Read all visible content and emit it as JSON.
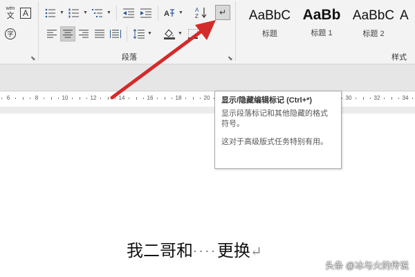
{
  "ribbon": {
    "font_group": {
      "phonetic_guide_text": "wén",
      "phonetic_guide_base": "文",
      "char_border_letter": "A",
      "enclose_char": "字"
    },
    "paragraph_group": {
      "label": "段落",
      "sort_label": "A Z",
      "show_marks_glyph": "↵"
    },
    "styles_group": {
      "label": "样式",
      "items": [
        {
          "sample": "AaBbC",
          "name": "标题"
        },
        {
          "sample": "AaBb",
          "name": "标题 1"
        },
        {
          "sample": "AaBbC",
          "name": "标题 2"
        }
      ]
    }
  },
  "ruler": {
    "numbers": [
      "6",
      "8",
      "10",
      "12",
      "14",
      "16",
      "18",
      "20",
      "22",
      "24",
      "26",
      "28",
      "30",
      "32",
      "34"
    ]
  },
  "tooltip": {
    "title": "显示/隐藏编辑标记 (Ctrl+*)",
    "line1": "显示段落标记和其他隐藏的格式符号。",
    "line2": "这对于高级版式任务特别有用。"
  },
  "document": {
    "text_before": "我二哥和",
    "dots": "····",
    "text_after": "更换",
    "para_mark": "↵"
  },
  "watermark": "头条 @冰与火的传说",
  "colors": {
    "arrow": "#d42a2a",
    "ribbon_bg": "#f3f3f3"
  }
}
